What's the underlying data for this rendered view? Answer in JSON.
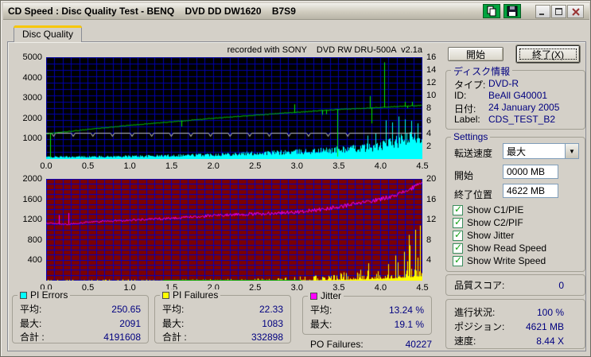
{
  "window": {
    "title": "CD Speed : Disc Quality Test - BENQ    DVD DD DW1620    B7S9"
  },
  "tab": {
    "label": "Disc Quality"
  },
  "chart_header": "recorded with SONY    DVD RW DRU-500A  v2.1a",
  "buttons": {
    "start": "開始",
    "exit": "終了(X)"
  },
  "disc_info": {
    "title": "ディスク情報",
    "rows": [
      {
        "label": "タイプ:",
        "value": "DVD-R"
      },
      {
        "label": "ID:",
        "value": "BeAll G40001"
      },
      {
        "label": "日付:",
        "value": "24 January 2005"
      },
      {
        "label": "Label:",
        "value": "CDS_TEST_B2"
      }
    ]
  },
  "settings": {
    "title": "Settings",
    "speed_label": "転送速度",
    "speed_value": "最大",
    "start_label": "開始",
    "start_value": "0000 MB",
    "end_label": "終了位置",
    "end_value": "4622 MB",
    "checkboxes": [
      "Show C1/PIE",
      "Show C2/PIF",
      "Show Jitter",
      "Show Read Speed",
      "Show Write Speed"
    ]
  },
  "quality": {
    "label": "品質スコア:",
    "value": "0"
  },
  "progress": {
    "rows": [
      {
        "label": "進行状況:",
        "value": "100 %"
      },
      {
        "label": "ポジション:",
        "value": "4621 MB"
      },
      {
        "label": "速度:",
        "value": "8.44 X"
      }
    ]
  },
  "stats": {
    "pi_errors": {
      "title": "PI Errors",
      "color": "#00FFFF",
      "rows": [
        {
          "label": "平均:",
          "value": "250.65"
        },
        {
          "label": "最大:",
          "value": "2091"
        },
        {
          "label": "合計 :",
          "value": "4191608"
        }
      ]
    },
    "pi_failures": {
      "title": "PI Failures",
      "color": "#FFFF00",
      "rows": [
        {
          "label": "平均:",
          "value": "22.33"
        },
        {
          "label": "最大:",
          "value": "1083"
        },
        {
          "label": "合計 :",
          "value": "332898"
        }
      ]
    },
    "jitter": {
      "title": "Jitter",
      "color": "#FF00FF",
      "rows": [
        {
          "label": "平均:",
          "value": "13.24 %"
        },
        {
          "label": "最大:",
          "value": "19.1 %"
        }
      ]
    },
    "po_failures": {
      "label": "PO Failures:",
      "value": "40227"
    }
  },
  "chart_data": [
    {
      "id": "top-chart",
      "type": "area",
      "title": "recorded with SONY    DVD RW DRU-500A  v2.1a",
      "x_range": [
        0,
        4.5
      ],
      "x_grid_step": 0.1,
      "x_ticks": [
        "0.0",
        "0.5",
        "1.0",
        "1.5",
        "2.0",
        "2.5",
        "3.0",
        "3.5",
        "4.0",
        "4.5"
      ],
      "left_axis": {
        "range": [
          0,
          5000
        ],
        "ticks": [
          5000,
          4000,
          3000,
          2000,
          1000
        ]
      },
      "right_axis": {
        "range": [
          0,
          16
        ],
        "ticks": [
          16,
          14,
          12,
          10,
          8,
          6,
          4,
          2
        ],
        "grid_step": 1
      },
      "bg": "#000000",
      "grid_color": "#0000AE",
      "seed": 42,
      "series": [
        {
          "name": "PI Errors",
          "type": "noisy-area",
          "axis": "left",
          "color": "#00FFFF",
          "spiky": false,
          "anchors_x": [
            0,
            0.25,
            0.5,
            0.75,
            1,
            1.25,
            1.5,
            1.75,
            2,
            2.25,
            2.5,
            2.75,
            3,
            3.25,
            3.5,
            3.75,
            4,
            4.2,
            4.35,
            4.5
          ],
          "anchors_y": [
            140,
            145,
            155,
            165,
            185,
            205,
            235,
            265,
            305,
            345,
            385,
            430,
            480,
            545,
            625,
            730,
            870,
            1150,
            1350,
            1500
          ],
          "spikes": [
            {
              "x": 3.85,
              "v": 1150
            },
            {
              "x": 3.95,
              "v": 1250
            },
            {
              "x": 4.07,
              "v": 1900
            },
            {
              "x": 4.15,
              "v": 1800
            },
            {
              "x": 4.22,
              "v": 2091
            },
            {
              "x": 4.3,
              "v": 1950
            },
            {
              "x": 4.38,
              "v": 1880
            },
            {
              "x": 4.45,
              "v": 1750
            }
          ]
        },
        {
          "name": "Write Speed",
          "type": "dipline",
          "axis": "right",
          "color": "#C8C8C8",
          "level": 4.05,
          "dip_depth": 0.5,
          "dip_start": 0.09,
          "dip_interval": 0.235,
          "dip_end": 3.68,
          "dip_halfwidth": 0.022
        },
        {
          "name": "Read Speed",
          "type": "noisy-line",
          "axis": "right",
          "color": "#00EE00",
          "noise": 0.05,
          "noise_grow": false,
          "anchors_x": [
            0,
            0.5,
            1,
            1.5,
            2,
            2.5,
            3,
            3.5,
            4,
            4.5
          ],
          "anchors_y": [
            3.95,
            4.65,
            5.3,
            5.85,
            6.4,
            6.9,
            7.35,
            7.78,
            8.12,
            8.44
          ],
          "spikes": [
            {
              "x": 0.045,
              "v": 0.2
            },
            {
              "x": 1.62,
              "v": 5.1
            },
            {
              "x": 2.97,
              "v": 8.6
            },
            {
              "x": 2.99,
              "v": 7.3
            },
            {
              "x": 3.31,
              "v": 6.95
            },
            {
              "x": 3.36,
              "v": 7.05
            },
            {
              "x": 3.49,
              "v": 0.4
            },
            {
              "x": 3.88,
              "v": 9.9
            },
            {
              "x": 3.9,
              "v": 5.6
            },
            {
              "x": 4.05,
              "v": 15.2
            },
            {
              "x": 4.3,
              "v": 9.0
            },
            {
              "x": 4.33,
              "v": 8.0
            },
            {
              "x": 4.39,
              "v": 9.0
            }
          ]
        }
      ]
    },
    {
      "id": "bottom-chart",
      "type": "area",
      "x_range": [
        0,
        4.5
      ],
      "x_grid_step": 0.1,
      "x_ticks": [
        "0.0",
        "0.5",
        "1.0",
        "1.5",
        "2.0",
        "2.5",
        "3.0",
        "3.5",
        "4.0",
        "4.5"
      ],
      "left_axis": {
        "range": [
          0,
          2000
        ],
        "ticks": [
          2000,
          1600,
          1200,
          800,
          400
        ]
      },
      "right_axis": {
        "range": [
          0,
          20
        ],
        "ticks": [
          20,
          16,
          12,
          8,
          4
        ],
        "grid_step": 1
      },
      "bg": "#7C0000",
      "grid_color": "#0000C8",
      "seed": 1337,
      "series": [
        {
          "name": "PI Failures",
          "type": "noisy-area",
          "axis": "left",
          "color": "#FFFF00",
          "spiky": true,
          "anchors_x": [
            0,
            0.5,
            1,
            1.5,
            2,
            2.5,
            2.75,
            3,
            3.2,
            3.4,
            3.6,
            3.8,
            4,
            4.15,
            4.3,
            4.4,
            4.5
          ],
          "anchors_y": [
            18,
            20,
            22,
            26,
            32,
            45,
            55,
            75,
            115,
            165,
            230,
            330,
            460,
            570,
            750,
            920,
            1083
          ],
          "spikes": [
            {
              "x": 4.48,
              "v": 1083
            },
            {
              "x": 4.42,
              "v": 1000
            },
            {
              "x": 4.35,
              "v": 900
            }
          ]
        },
        {
          "name": "C2 baseline",
          "type": "hseg",
          "axis": "right",
          "color": "#00B400",
          "y": 0.12,
          "from": 1.4,
          "to": 3.05
        },
        {
          "name": "Jitter",
          "type": "noisy-line",
          "axis": "right",
          "color": "#FF00FF",
          "noise": 0.3,
          "noise_grow": true,
          "anchors_x": [
            0,
            0.25,
            0.5,
            0.75,
            1,
            1.25,
            1.5,
            1.75,
            2,
            2.25,
            2.5,
            2.75,
            3,
            3.25,
            3.5,
            3.75,
            4,
            4.25,
            4.4,
            4.5
          ],
          "anchors_y": [
            11.3,
            11.1,
            11.5,
            11.7,
            11.9,
            12.1,
            12.3,
            12.5,
            12.8,
            13.0,
            13.1,
            13.3,
            13.5,
            13.9,
            14.5,
            15.2,
            16.0,
            17.2,
            18.3,
            19.1
          ],
          "spikes": [
            {
              "x": 0.15,
              "v": 12.9
            },
            {
              "x": 0.27,
              "v": 13.3
            }
          ]
        }
      ]
    }
  ]
}
